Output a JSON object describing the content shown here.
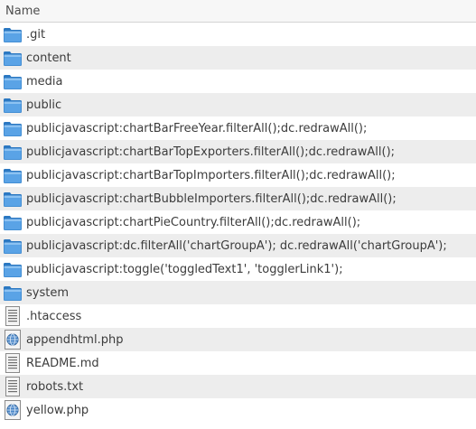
{
  "header": {
    "name_label": "Name"
  },
  "files": [
    {
      "name": ".git",
      "icon": "folder-icon"
    },
    {
      "name": "content",
      "icon": "folder-icon"
    },
    {
      "name": "media",
      "icon": "folder-icon"
    },
    {
      "name": "public",
      "icon": "folder-icon"
    },
    {
      "name": "publicjavascript:chartBarFreeYear.filterAll();dc.redrawAll();",
      "icon": "folder-icon"
    },
    {
      "name": "publicjavascript:chartBarTopExporters.filterAll();dc.redrawAll();",
      "icon": "folder-icon"
    },
    {
      "name": "publicjavascript:chartBarTopImporters.filterAll();dc.redrawAll();",
      "icon": "folder-icon"
    },
    {
      "name": "publicjavascript:chartBubbleImporters.filterAll();dc.redrawAll();",
      "icon": "folder-icon"
    },
    {
      "name": "publicjavascript:chartPieCountry.filterAll();dc.redrawAll();",
      "icon": "folder-icon"
    },
    {
      "name": "publicjavascript:dc.filterAll('chartGroupA'); dc.redrawAll('chartGroupA');",
      "icon": "folder-icon"
    },
    {
      "name": "publicjavascript:toggle('toggledText1', 'togglerLink1');",
      "icon": "folder-icon"
    },
    {
      "name": "system",
      "icon": "folder-icon"
    },
    {
      "name": ".htaccess",
      "icon": "text-file-icon"
    },
    {
      "name": "appendhtml.php",
      "icon": "web-file-icon"
    },
    {
      "name": "README.md",
      "icon": "text-file-icon"
    },
    {
      "name": "robots.txt",
      "icon": "text-file-icon"
    },
    {
      "name": "yellow.php",
      "icon": "web-file-icon"
    }
  ],
  "colors": {
    "folder_body": "#2f83d4",
    "folder_tab": "#5aa3e6",
    "row_alt": "#ededed",
    "text": "#3c3c3c"
  }
}
